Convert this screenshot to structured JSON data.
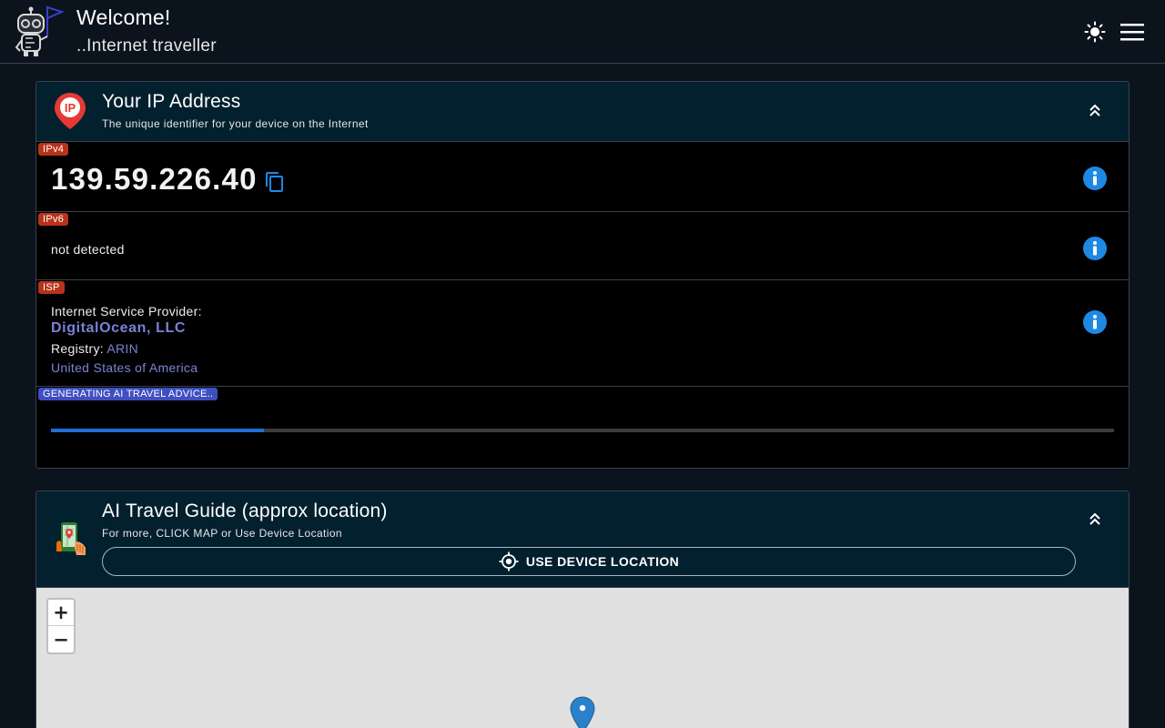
{
  "header": {
    "title": "Welcome!",
    "subtitle": "..Internet traveller",
    "logo_icon": "robot-with-flag-icon",
    "theme_icon": "sun-icon",
    "menu_icon": "hamburger-menu-icon"
  },
  "ip_card": {
    "title": "Your IP Address",
    "subtitle": "The unique identifier for your device on the Internet",
    "icon": "ip-location-pin-icon",
    "ipv4": {
      "tag": "IPv4",
      "value": "139.59.226.40"
    },
    "ipv6": {
      "tag": "IPv6",
      "value": "not detected"
    },
    "isp": {
      "tag": "ISP",
      "label": "Internet Service Provider:",
      "name": "DigitalOcean, LLC",
      "registry_label": "Registry: ",
      "registry": "ARIN",
      "country": "United States of America"
    },
    "ai": {
      "tag": "GENERATING AI TRAVEL ADVICE..",
      "progress": 0.2
    }
  },
  "travel_card": {
    "title": "AI Travel Guide (approx location)",
    "subtitle": "For more, CLICK MAP or Use Device Location",
    "icon": "phone-map-travel-icon",
    "location_button": "USE DEVICE LOCATION",
    "location_icon": "crosshair-gps-icon",
    "map": {
      "zoom_in": "+",
      "zoom_out": "−"
    }
  },
  "colors": {
    "background": "#0b131c",
    "card_header": "#03202f",
    "tag_red": "#b7331a",
    "tag_blue": "#3f4ec0",
    "link": "#7a82d6",
    "info_blue": "#1e88e5",
    "progress": "#1e6fd6"
  }
}
